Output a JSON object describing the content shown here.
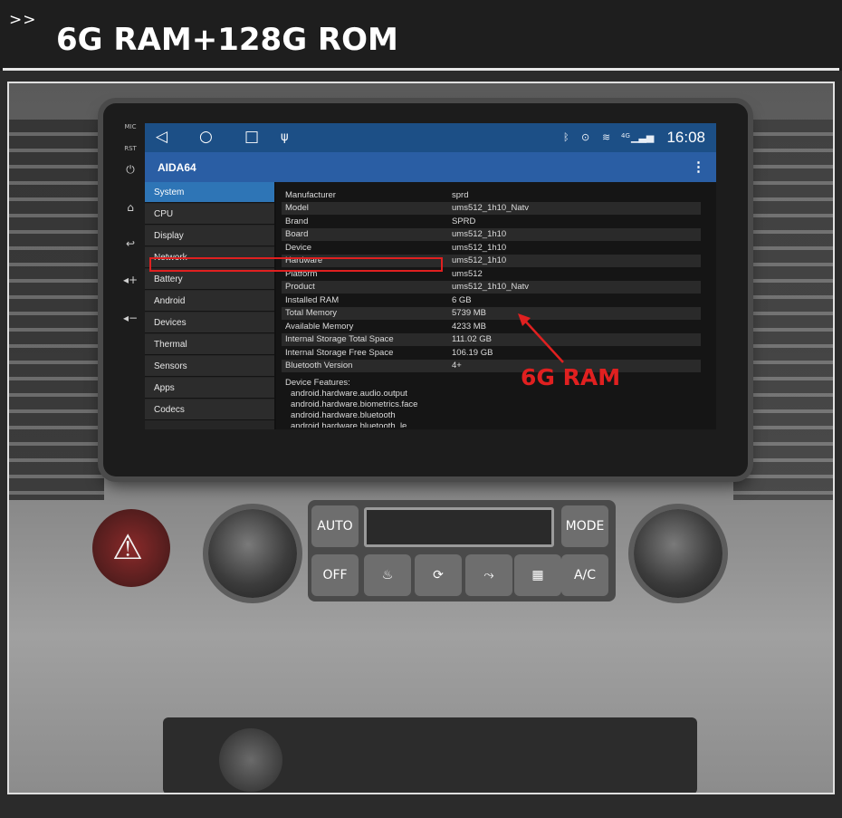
{
  "banner": {
    "chevron": ">>",
    "title": "6G RAM+128G ROM"
  },
  "side_buttons": {
    "mic_label": "MIC",
    "rst_label": "RST"
  },
  "status_bar": {
    "nav_icons": [
      "back-icon",
      "home-icon",
      "recents-icon",
      "usb-icon"
    ],
    "status_icons": [
      "bluetooth-icon",
      "location-icon",
      "wifi-icon",
      "signal-icon"
    ],
    "network_type": "4G",
    "time": "16:08",
    "bar_color": "#1c4f86"
  },
  "app_bar": {
    "title": "AIDA64",
    "menu_glyph": "⋮",
    "color": "#2a5ea4"
  },
  "sidebar": {
    "accent": "#2e75b6",
    "items": [
      {
        "label": "System",
        "active": true
      },
      {
        "label": "CPU"
      },
      {
        "label": "Display"
      },
      {
        "label": "Network"
      },
      {
        "label": "Battery"
      },
      {
        "label": "Android"
      },
      {
        "label": "Devices"
      },
      {
        "label": "Thermal"
      },
      {
        "label": "Sensors"
      },
      {
        "label": "Apps"
      },
      {
        "label": "Codecs"
      }
    ]
  },
  "system_info": {
    "rows": [
      {
        "key": "Manufacturer",
        "value": "sprd"
      },
      {
        "key": "Model",
        "value": "ums512_1h10_Natv"
      },
      {
        "key": "Brand",
        "value": "SPRD"
      },
      {
        "key": "Board",
        "value": "ums512_1h10"
      },
      {
        "key": "Device",
        "value": "ums512_1h10"
      },
      {
        "key": "Hardware",
        "value": "ums512_1h10"
      },
      {
        "key": "Platform",
        "value": "ums512"
      },
      {
        "key": "Product",
        "value": "ums512_1h10_Natv"
      },
      {
        "key": "Installed RAM",
        "value": "6 GB"
      },
      {
        "key": "Total Memory",
        "value": "5739 MB"
      },
      {
        "key": "Available Memory",
        "value": "4233 MB"
      },
      {
        "key": "Internal Storage Total Space",
        "value": "111.02 GB"
      },
      {
        "key": "Internal Storage Free Space",
        "value": "106.19 GB"
      },
      {
        "key": "Bluetooth Version",
        "value": "4+"
      }
    ],
    "features_title": "Device Features:",
    "features": [
      "android.hardware.audio.output",
      "android.hardware.biometrics.face",
      "android.hardware.bluetooth",
      "android.hardware.bluetooth_le"
    ]
  },
  "annotation": {
    "callout": "6G RAM",
    "color": "#e02020"
  },
  "climate_panel": {
    "auto_label": "AUTO",
    "mode_label": "MODE",
    "off_label": "OFF",
    "ac_label": "A/C"
  }
}
